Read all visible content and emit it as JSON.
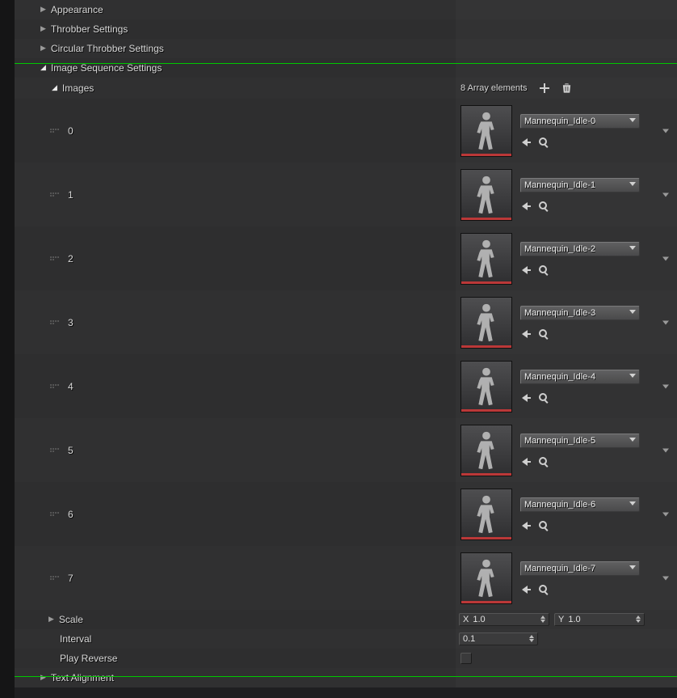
{
  "categories": {
    "appearance": "Appearance",
    "throbber": "Throbber Settings",
    "circular": "Circular Throbber Settings",
    "imgseq": "Image Sequence Settings",
    "textalign": "Text Alignment"
  },
  "imgseq": {
    "images_label": "Images",
    "array_summary": "8 Array elements",
    "items": [
      {
        "index": "0",
        "asset": "Mannequin_Idle-0"
      },
      {
        "index": "1",
        "asset": "Mannequin_Idle-1"
      },
      {
        "index": "2",
        "asset": "Mannequin_Idle-2"
      },
      {
        "index": "3",
        "asset": "Mannequin_Idle-3"
      },
      {
        "index": "4",
        "asset": "Mannequin_Idle-4"
      },
      {
        "index": "5",
        "asset": "Mannequin_Idle-5"
      },
      {
        "index": "6",
        "asset": "Mannequin_Idle-6"
      },
      {
        "index": "7",
        "asset": "Mannequin_Idle-7"
      }
    ],
    "scale_label": "Scale",
    "scale": {
      "x_prefix": "X",
      "x": "1.0",
      "y_prefix": "Y",
      "y": "1.0"
    },
    "interval_label": "Interval",
    "interval": "0.1",
    "playrev_label": "Play Reverse",
    "playrev": false
  },
  "icons": {
    "add": "add-icon",
    "delete": "trash-icon",
    "useSelected": "use-selected-arrow-icon",
    "browse": "browse-magnifier-icon",
    "dropdown": "chevron-down-icon"
  }
}
